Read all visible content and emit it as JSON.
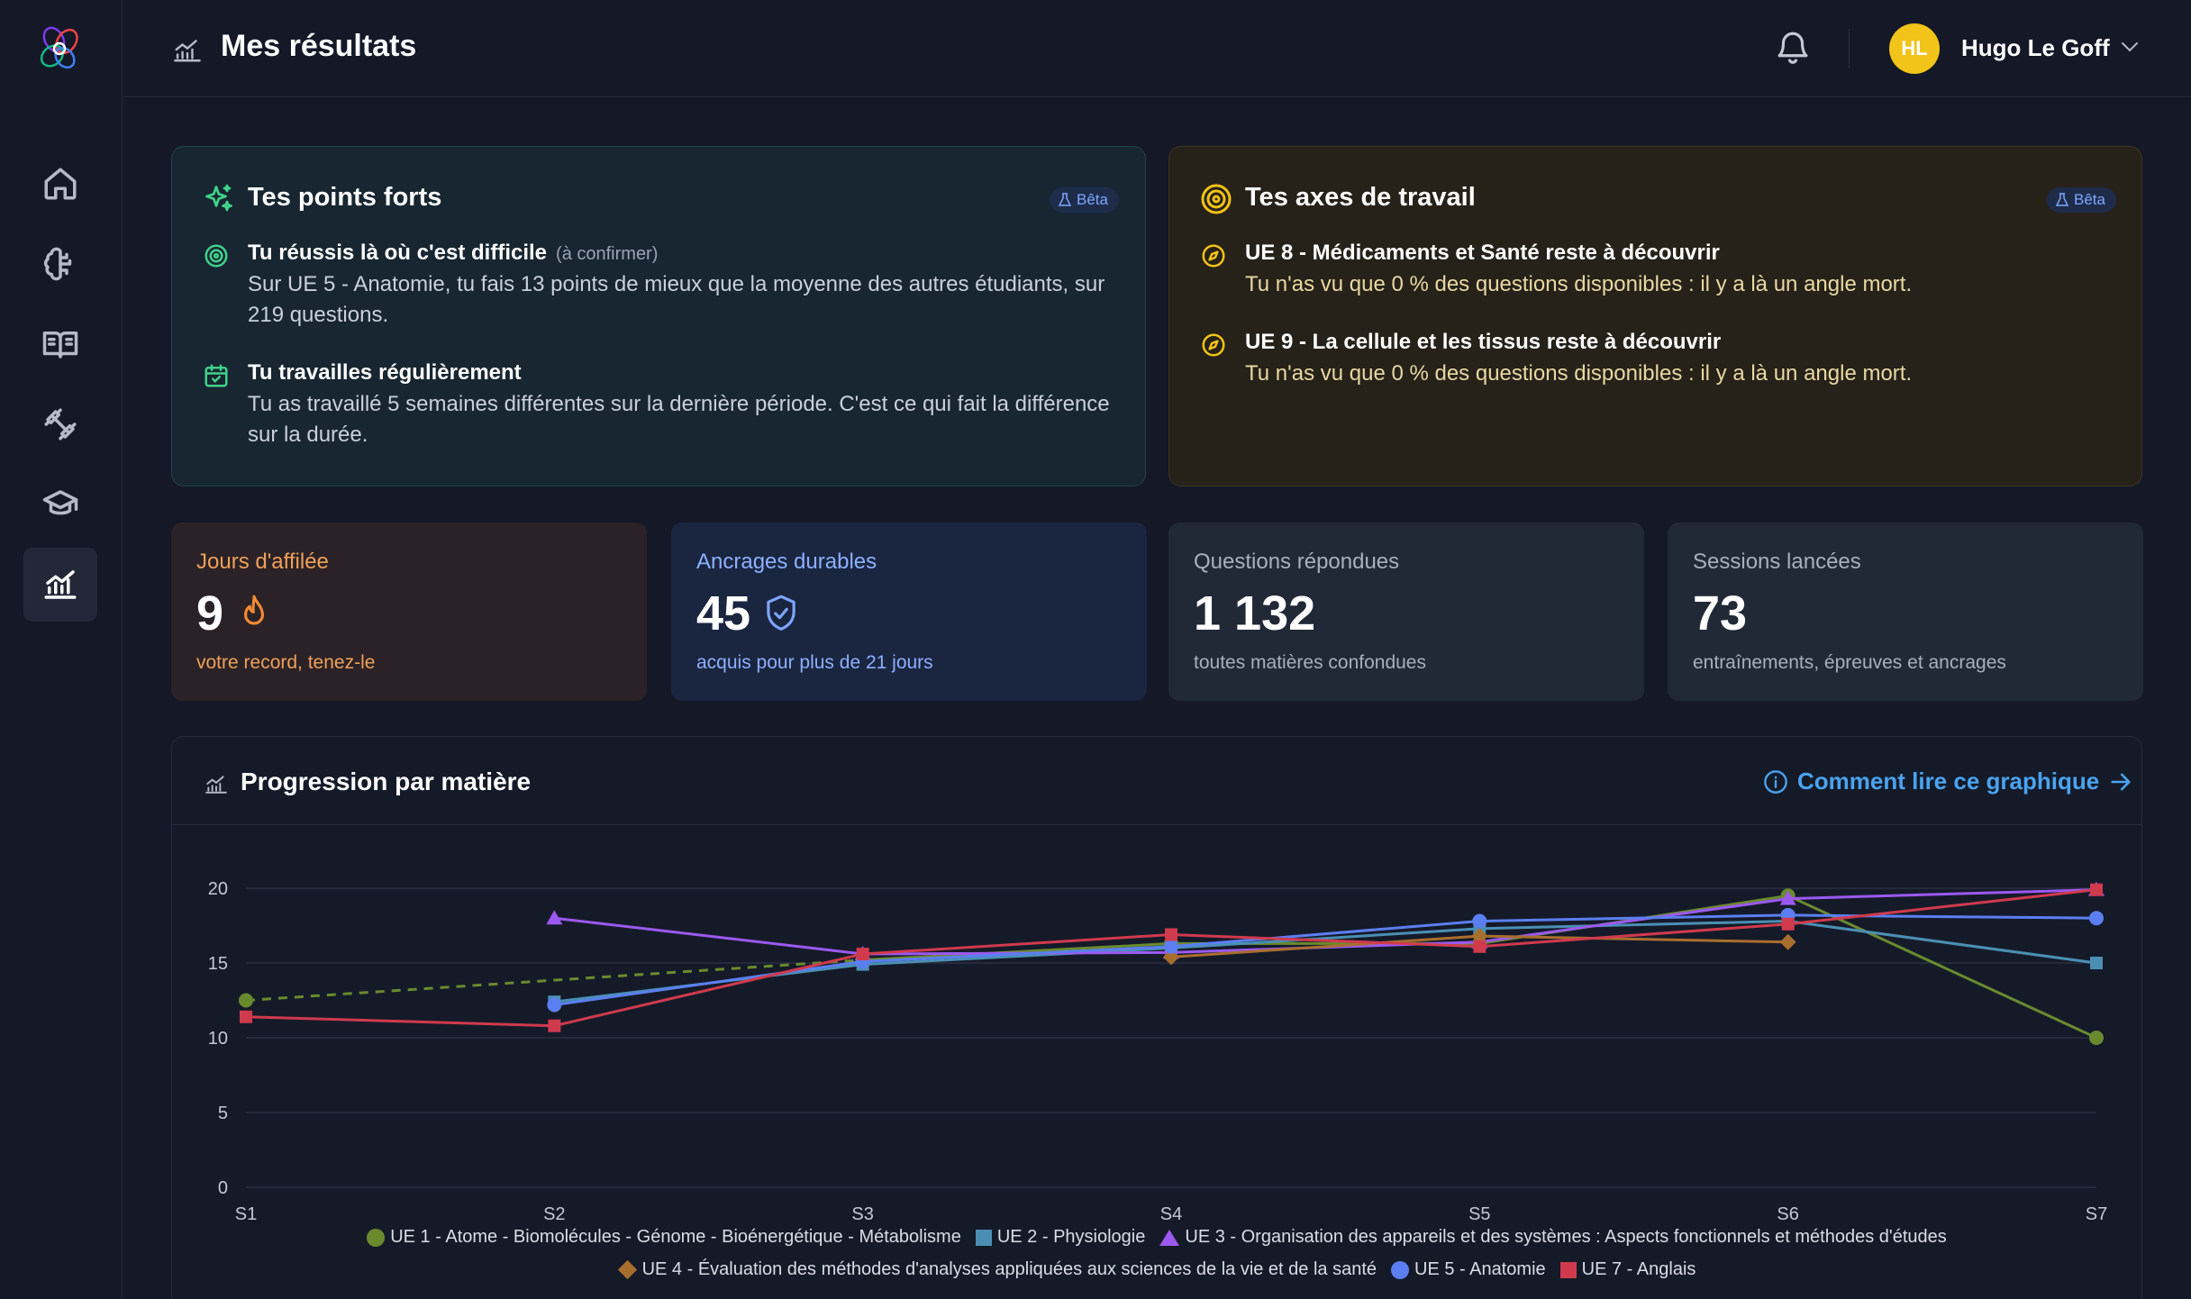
{
  "header": {
    "title": "Mes résultats",
    "user": {
      "initials": "HL",
      "name": "Hugo Le Goff"
    }
  },
  "sidebar": {
    "items": [
      {
        "name": "home",
        "active": false
      },
      {
        "name": "brain",
        "active": false
      },
      {
        "name": "book",
        "active": false
      },
      {
        "name": "dumbbell",
        "active": false
      },
      {
        "name": "graduation-cap",
        "active": false
      },
      {
        "name": "chart",
        "active": true
      }
    ]
  },
  "strengths": {
    "title": "Tes points forts",
    "beta": "Bêta",
    "items": [
      {
        "title": "Tu réussis là où c'est difficile",
        "hint": "(à confirmer)",
        "text": "Sur UE 5 - Anatomie, tu fais 13 points de mieux que la moyenne des autres étudiants, sur 219 questions."
      },
      {
        "title": "Tu travailles régulièrement",
        "hint": "",
        "text": "Tu as travaillé 5 semaines différentes sur la dernière période. C'est ce qui fait la différence sur la durée."
      }
    ]
  },
  "axes": {
    "title": "Tes axes de travail",
    "beta": "Bêta",
    "items": [
      {
        "title": "UE 8 - Médicaments et Santé reste à découvrir",
        "text": "Tu n'as vu que 0 % des questions disponibles : il y a là un angle mort."
      },
      {
        "title": "UE 9 - La cellule et les tissus reste à découvrir",
        "text": "Tu n'as vu que 0 % des questions disponibles : il y a là un angle mort."
      }
    ]
  },
  "stats": {
    "streak": {
      "label": "Jours d'affilée",
      "value": "9",
      "sub": "votre record, tenez-le",
      "icon": "flame-icon"
    },
    "anchors": {
      "label": "Ancrages durables",
      "value": "45",
      "sub": "acquis pour plus de 21 jours",
      "icon": "shield-check-icon"
    },
    "questions": {
      "label": "Questions répondues",
      "value": "1 132",
      "sub": "toutes matières confondues"
    },
    "sessions": {
      "label": "Sessions lancées",
      "value": "73",
      "sub": "entraînements, épreuves et ancrages"
    }
  },
  "chart": {
    "title": "Progression par matière",
    "help_link": "Comment lire ce graphique"
  },
  "chart_data": {
    "type": "line",
    "categories": [
      "S1",
      "S2",
      "S3",
      "S4",
      "S5",
      "S6",
      "S7"
    ],
    "ylim": [
      0,
      20
    ],
    "yticks": [
      0,
      5,
      10,
      15,
      20
    ],
    "grid": true,
    "legend_position": "bottom",
    "series": [
      {
        "name": "UE 1 - Atome - Biomolécules - Génome - Bioénergétique - Métabolisme",
        "color": "#6a8a2e",
        "marker": "circle",
        "values": [
          12.5,
          null,
          15.2,
          16.3,
          16.3,
          19.5,
          10.0
        ]
      },
      {
        "name": "UE 2 - Physiologie",
        "color": "#4a8fb3",
        "marker": "square",
        "values": [
          null,
          12.4,
          14.9,
          16.0,
          17.3,
          17.8,
          15.0
        ]
      },
      {
        "name": "UE 3 - Organisation des appareils et des systèmes : Aspects fonctionnels et méthodes d'études",
        "color": "#9b59f0",
        "marker": "triangle",
        "values": [
          null,
          18.0,
          15.6,
          15.7,
          16.4,
          19.3,
          19.9
        ]
      },
      {
        "name": "UE 4 - Évaluation des méthodes d'analyses appliquées aux sciences de la vie et de la santé",
        "color": "#a86e2e",
        "marker": "diamond",
        "values": [
          null,
          null,
          null,
          15.4,
          16.8,
          16.4,
          null
        ]
      },
      {
        "name": "UE 5 - Anatomie",
        "color": "#5b7ff0",
        "marker": "circle",
        "values": [
          null,
          12.2,
          15.1,
          16.1,
          17.8,
          18.2,
          18.0
        ]
      },
      {
        "name": "UE 7 - Anglais",
        "color": "#d03a4d",
        "marker": "square",
        "values": [
          11.4,
          10.8,
          15.6,
          16.9,
          16.1,
          17.6,
          19.9
        ]
      }
    ]
  }
}
